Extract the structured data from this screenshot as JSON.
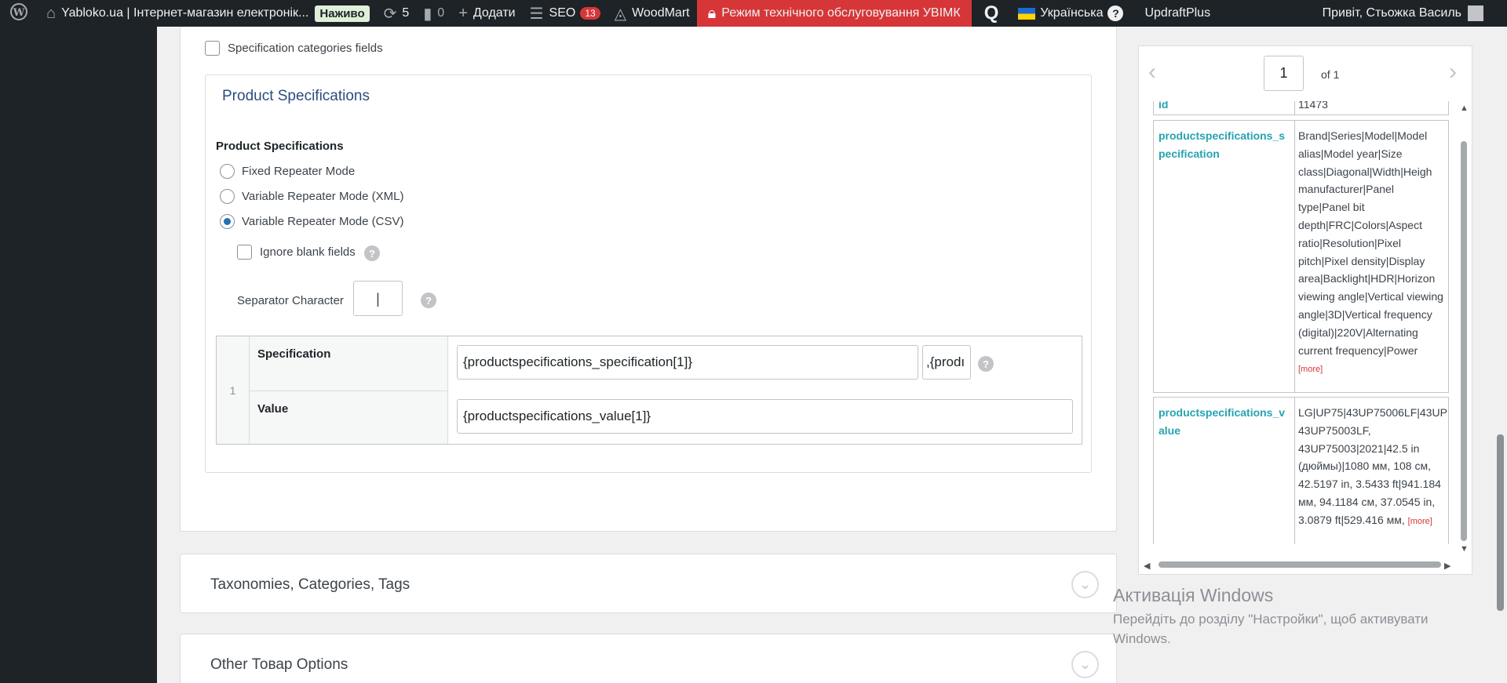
{
  "adminbar": {
    "site_name": "Yabloko.ua | Інтернет-магазин електронік...",
    "live_badge": "Наживо",
    "updates_count": "5",
    "comments_count": "0",
    "add_label": "Додати",
    "seo_label": "SEO",
    "seo_count": "13",
    "woodmart_label": "WoodMart",
    "maintenance_label": "Режим технічного обслуговування УВІМК",
    "language_label": "Українська",
    "updraft_label": "UpdraftPlus",
    "greeting": "Привіт, Стьожка Василь"
  },
  "form": {
    "spec_categories_label": "Specification categories fields",
    "box_title": "Product Specifications",
    "group_label": "Product Specifications",
    "mode_options": [
      "Fixed Repeater Mode",
      "Variable Repeater Mode (XML)",
      "Variable Repeater Mode (CSV)"
    ],
    "selected_mode": "Variable Repeater Mode (CSV)",
    "ignore_blank_label": "Ignore blank fields",
    "separator_label": "Separator Character",
    "separator_value": "|",
    "row_number": "1",
    "spec_key": "Specification",
    "spec_value": "{productspecifications_specification[1]}",
    "spec_extra_value": ",{prodı",
    "value_key": "Value",
    "value_value": "{productspecifications_value[1]}"
  },
  "sections": [
    "Taxonomies, Categories, Tags",
    "Other Товар Options"
  ],
  "preview": {
    "page_value": "1",
    "page_of": "of 1",
    "rows": [
      {
        "key": "id",
        "value": "11473",
        "more": ""
      },
      {
        "key": "productspecifications_specification",
        "value": "Brand|Series|Model|Model alias|Model year|Size class|Diagonal|Width|Heigh manufacturer|Panel type|Panel bit depth|FRC|Colors|Aspect ratio|Resolution|Pixel pitch|Pixel density|Display area|Backlight|HDR|Horizon viewing angle|Vertical viewing angle|3D|Vertical frequency (digital)|220V|Alternating current frequency|Power",
        "more": "[more]"
      },
      {
        "key": "productspecifications_value",
        "value": "LG|UP75|43UP75006LF|43UP 43UP75003LF, 43UP75003|2021|42.5 in (дюймы)|1080 мм, 108 см, 42.5197 in, 3.5433 ft|941.184 мм, 94.1184 см, 37.0545 in, 3.0879 ft|529.416 мм,",
        "more": "[more]"
      }
    ]
  },
  "windows_notice": {
    "title": "Активація Windows",
    "subtitle": "Перейдіть до розділу \"Настройки\", щоб активувати Windows."
  },
  "icons": [
    "wordpress-icon",
    "home-icon",
    "updates-icon",
    "comments-icon",
    "plus-icon",
    "seo-icon",
    "woodmart-icon",
    "lock-icon",
    "q-icon",
    "flag-icon",
    "help-icon",
    "avatar-icon",
    "chevron-down-icon",
    "chevron-left-icon",
    "chevron-right-icon"
  ]
}
